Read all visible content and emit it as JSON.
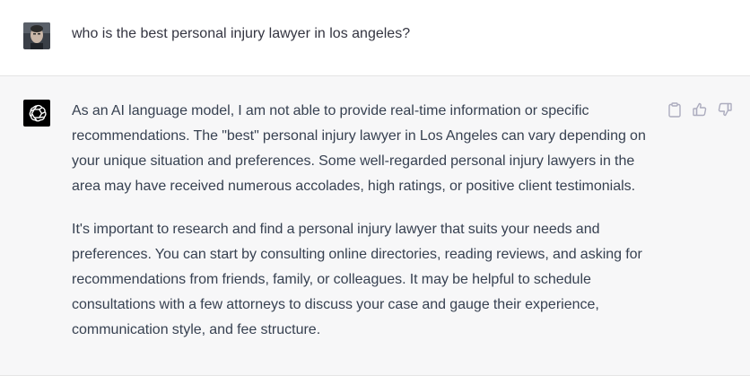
{
  "user": {
    "avatar": "user-avatar-photo",
    "message": "who is the best personal injury lawyer in los angeles?"
  },
  "assistant": {
    "avatar": "openai-logo-icon",
    "paragraphs": [
      "As an AI language model, I am not able to provide real-time information or specific recommendations. The \"best\" personal injury lawyer in Los Angeles can vary depending on your unique situation and preferences. Some well-regarded personal injury lawyers in the area may have received numerous accolades, high ratings, or positive client testimonials.",
      "It's important to research and find a personal injury lawyer that suits your needs and preferences. You can start by consulting online directories, reading reviews, and asking for recommendations from friends, family, or colleagues. It may be helpful to schedule consultations with a few attorneys to discuss your case and gauge their experience, communication style, and fee structure."
    ],
    "actions": [
      {
        "icon": "clipboard-icon"
      },
      {
        "icon": "thumbs-up-icon"
      },
      {
        "icon": "thumbs-down-icon"
      }
    ]
  },
  "colors": {
    "user_bg": "#ffffff",
    "assistant_bg": "#f7f7f8",
    "text": "#374151",
    "icon": "#acacbe"
  }
}
